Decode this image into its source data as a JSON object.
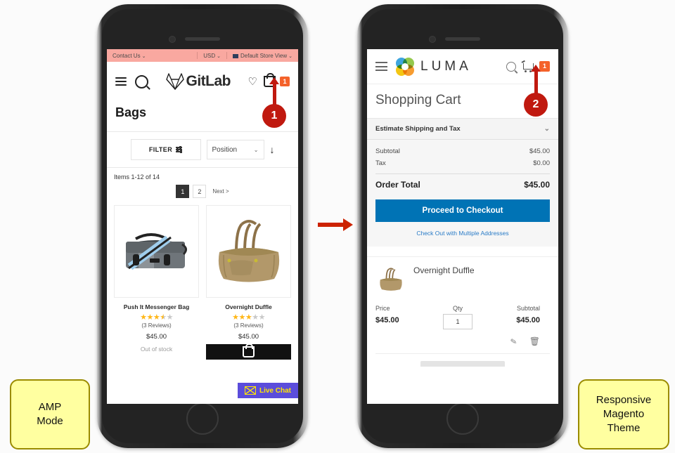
{
  "left_phone": {
    "topbar": {
      "contact": "Contact Us",
      "currency": "USD",
      "store_view": "Default Store View"
    },
    "header": {
      "brand": "GitLab",
      "menu_icon": "hamburger-icon",
      "search_icon": "search-icon",
      "wishlist_icon": "heart-icon",
      "cart_icon": "shopping-bag-icon",
      "cart_count": "1"
    },
    "page_title": "Bags",
    "controls": {
      "filter_label": "FILTER",
      "sort_value": "Position",
      "sort_direction_icon": "arrow-down-icon"
    },
    "items_count": "Items 1-12 of 14",
    "pagination": {
      "pages": [
        "1",
        "2"
      ],
      "active": "1",
      "next_label": "Next >"
    },
    "products": [
      {
        "name": "Push It Messenger Bag",
        "rating": 3.5,
        "reviews": "(3 Reviews)",
        "price": "$45.00",
        "stock": "Out of stock",
        "image": "messenger-bag-image"
      },
      {
        "name": "Overnight Duffle",
        "rating": 3,
        "reviews": "(3 Reviews)",
        "price": "$45.00",
        "stock": "",
        "image": "duffle-bag-image"
      }
    ],
    "live_chat": "Live Chat"
  },
  "right_phone": {
    "header": {
      "brand": "LUMA",
      "menu_icon": "hamburger-icon",
      "logo_icon": "luma-logo-icon",
      "search_icon": "search-icon",
      "cart_icon": "shopping-cart-icon",
      "cart_count": "1"
    },
    "page_title": "Shopping Cart",
    "estimate_row": "Estimate Shipping and Tax",
    "totals": [
      {
        "label": "Subtotal",
        "value": "$45.00"
      },
      {
        "label": "Tax",
        "value": "$0.00"
      }
    ],
    "order_total": {
      "label": "Order Total",
      "value": "$45.00"
    },
    "checkout_button": "Proceed to Checkout",
    "multi_address_link": "Check Out with Multiple Addresses",
    "cart_item": {
      "name": "Overnight Duffle",
      "thumb": "duffle-bag-thumb",
      "price_label": "Price",
      "price_value": "$45.00",
      "qty_label": "Qty",
      "qty_value": "1",
      "subtotal_label": "Subtotal",
      "subtotal_value": "$45.00",
      "edit_icon": "pencil-icon",
      "delete_icon": "trash-icon"
    }
  },
  "callouts": [
    {
      "number": "1"
    },
    {
      "number": "2"
    }
  ],
  "notes": {
    "left": "AMP\nMode",
    "right": "Responsive\nMagento\nTheme"
  },
  "colors": {
    "accent_red": "#c0190f",
    "arrow_red": "#cc2200",
    "cart_badge": "#f4622a",
    "checkout_blue": "#0073b5",
    "amp_topbar": "#f9a8a0",
    "note_yellow": "#ffffa0",
    "star_gold": "#ffb718"
  }
}
